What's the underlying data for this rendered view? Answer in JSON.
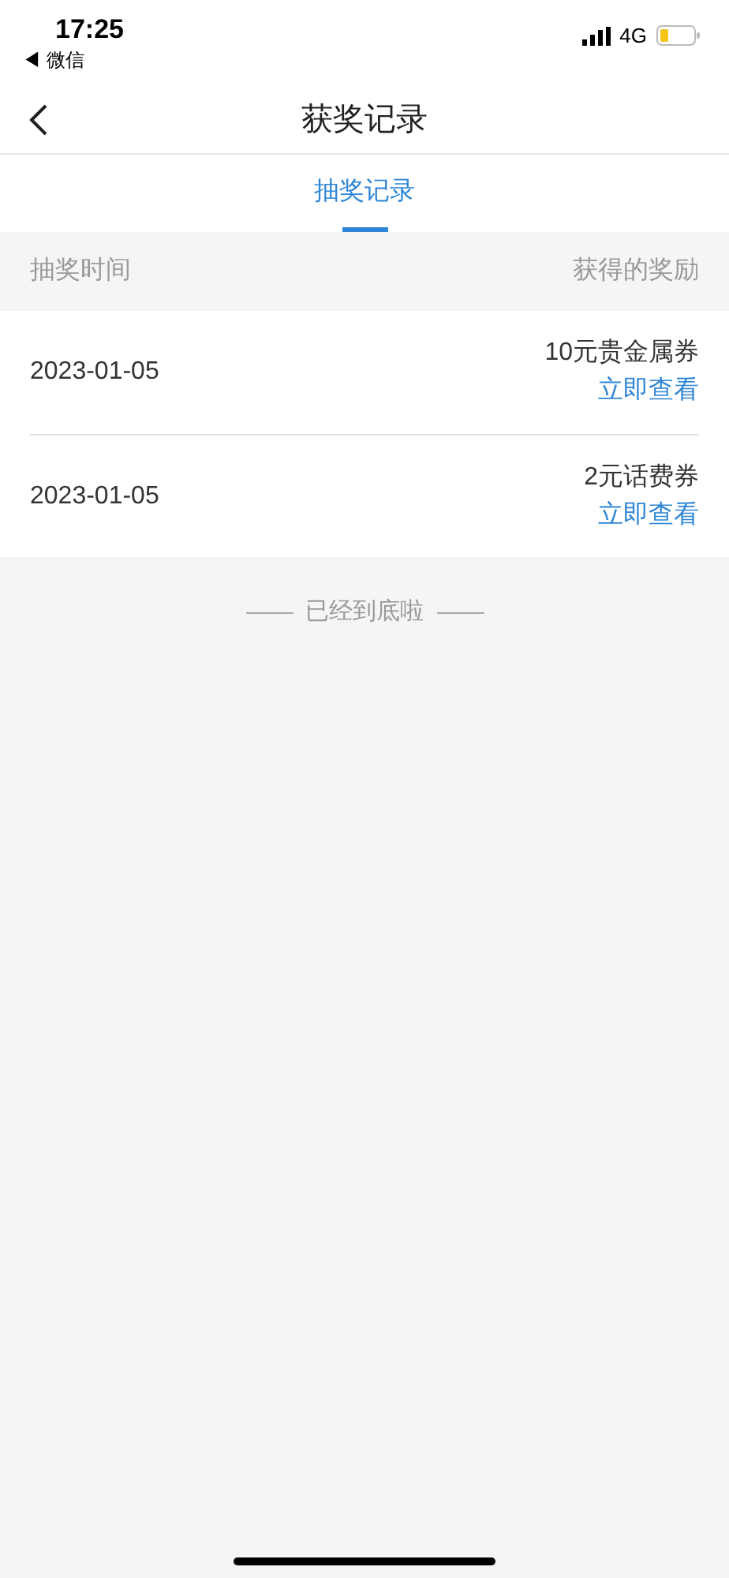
{
  "status_bar": {
    "time": "17:25",
    "back_app": "◀ 微信",
    "network": "4G"
  },
  "nav": {
    "title": "获奖记录"
  },
  "tabs": [
    {
      "label": "抽奖记录",
      "selected": true
    }
  ],
  "table": {
    "columns": [
      "抽奖时间",
      "获得的奖励"
    ],
    "rows": [
      {
        "date": "2023-01-05",
        "prize": "10元贵金属券",
        "action": "立即查看"
      },
      {
        "date": "2023-01-05",
        "prize": "2元话费券",
        "action": "立即查看"
      }
    ]
  },
  "end_note": "已经到底啦"
}
